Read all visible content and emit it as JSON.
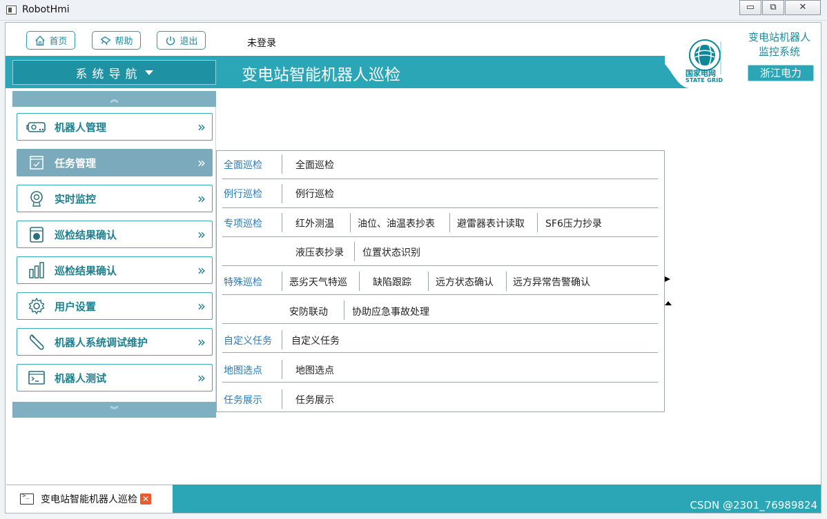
{
  "window": {
    "title": "RobotHmi",
    "minimize": "▭",
    "maximize": "⧉",
    "close": "✕"
  },
  "toolbar": {
    "home_label": "首页",
    "help_label": "帮助",
    "exit_label": "退出",
    "login_status": "未登录"
  },
  "header": {
    "nav_label": "系统导航",
    "main_title": "变电站智能机器人巡检",
    "system_name_line1": "变电站机器人",
    "system_name_line2": "监控系统",
    "company": "浙江电力",
    "logo_cn": "国家电网",
    "logo_en": "STATE GRID",
    "brand_color": "#2ba6b7"
  },
  "sidebar": {
    "scroll_up": "︽",
    "scroll_down": "︾",
    "items": [
      {
        "label": "机器人管理",
        "icon": "robot-icon"
      },
      {
        "label": "任务管理",
        "icon": "task-icon",
        "active": true
      },
      {
        "label": "实时监控",
        "icon": "monitor-icon"
      },
      {
        "label": "巡检结果确认",
        "icon": "record-icon"
      },
      {
        "label": "巡检结果确认",
        "icon": "bar-chart-icon"
      },
      {
        "label": "用户设置",
        "icon": "gear-icon"
      },
      {
        "label": "机器人系统调试维护",
        "icon": "wrench-icon"
      },
      {
        "label": "机器人测试",
        "icon": "terminal-icon"
      }
    ],
    "chevron": "»"
  },
  "task_menu": {
    "rows": [
      {
        "category": "全面巡检",
        "items": [
          "全面巡检"
        ]
      },
      {
        "category": "例行巡检",
        "items": [
          "例行巡检"
        ]
      },
      {
        "category": "专项巡检",
        "items": [
          "红外测温",
          "油位、油温表抄表",
          "避雷器表计读取",
          "SF6压力抄录"
        ]
      },
      {
        "category": "",
        "items": [
          "液压表抄录",
          "位置状态识别"
        ]
      },
      {
        "category": "特殊巡检",
        "items": [
          "恶劣天气特巡",
          "缺陷跟踪",
          "远方状态确认",
          "远方异常告警确认"
        ]
      },
      {
        "category": "",
        "items": [
          "安防联动",
          "协助应急事故处理"
        ]
      },
      {
        "category": "自定义任务",
        "items": [
          "自定义任务"
        ]
      },
      {
        "category": "地图选点",
        "items": [
          "地图选点"
        ]
      },
      {
        "category": "任务展示",
        "items": [
          "任务展示"
        ]
      }
    ]
  },
  "bottom_tab": {
    "label": "变电站智能机器人巡检",
    "close": "✕"
  },
  "watermark": "CSDN @2301_76989824"
}
